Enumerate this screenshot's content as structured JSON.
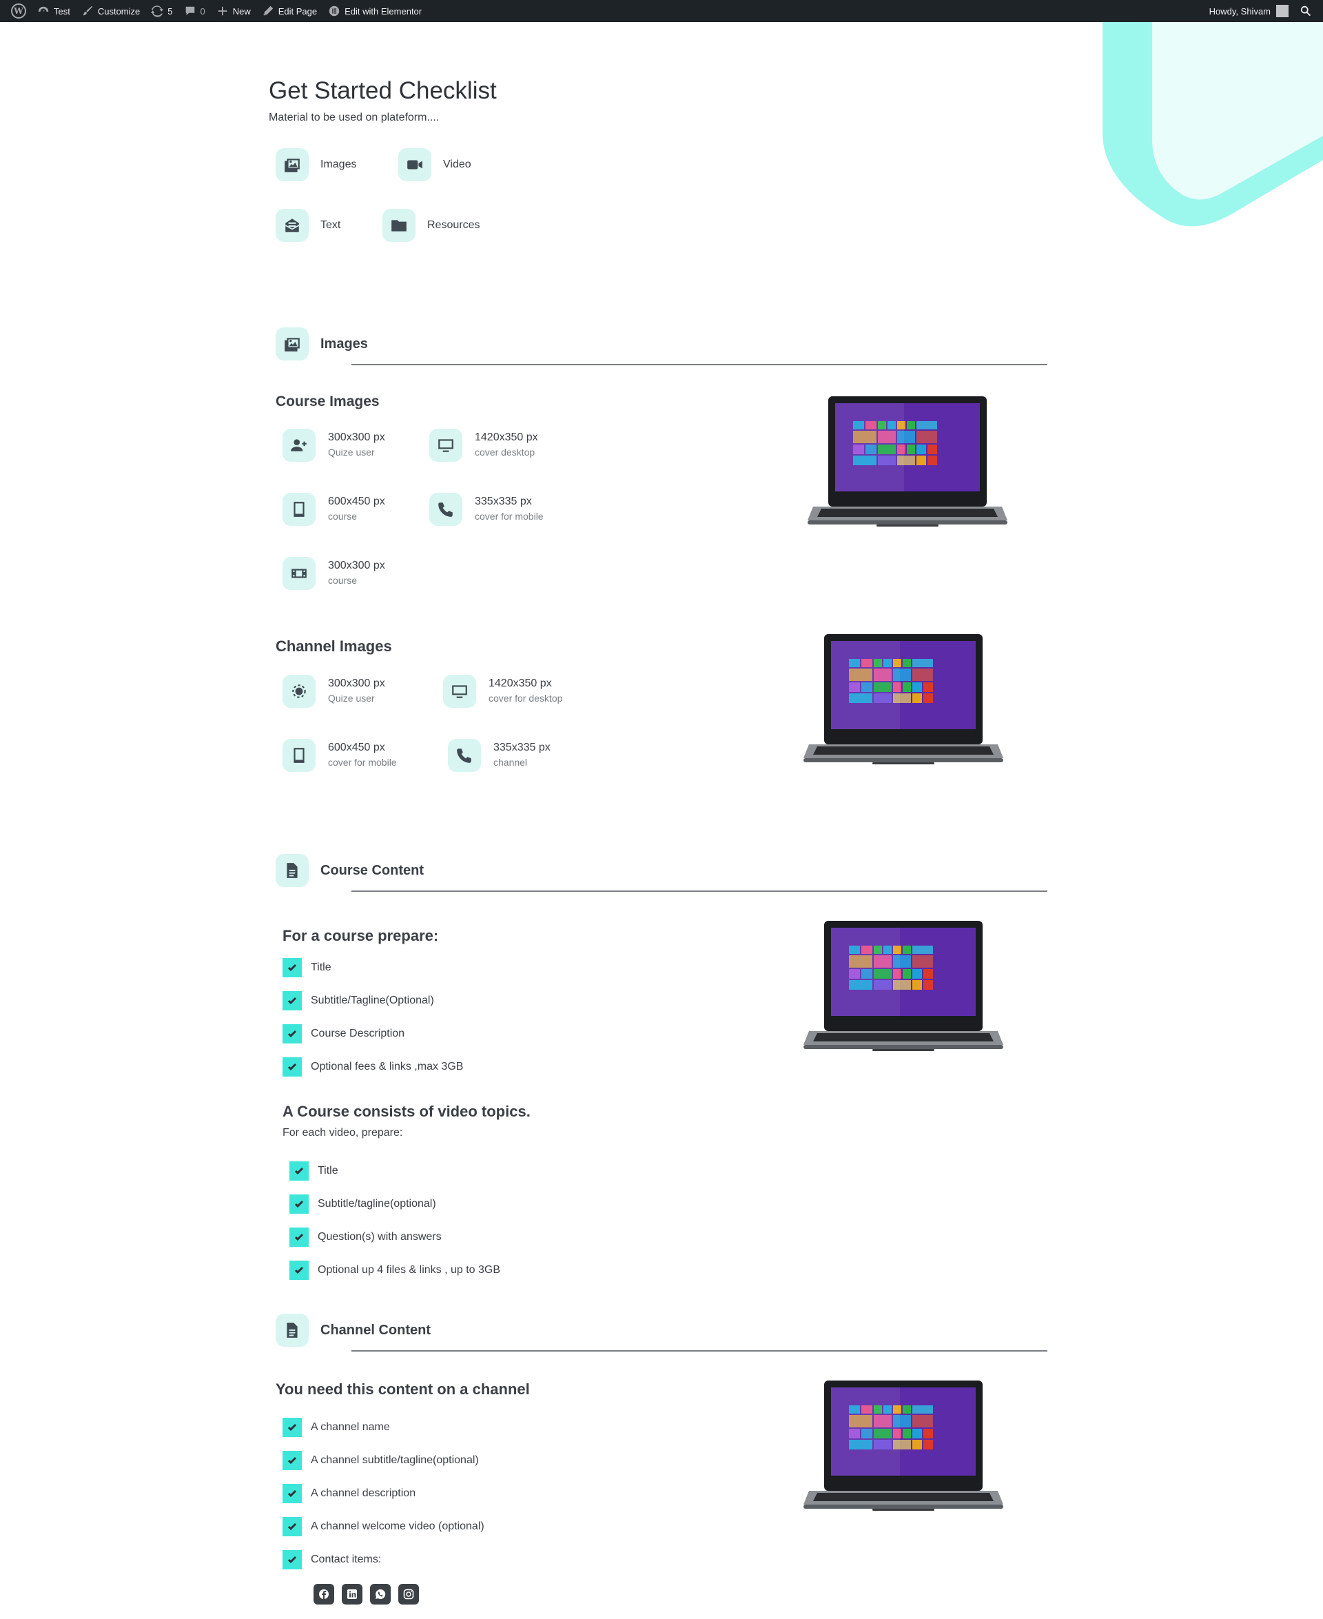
{
  "admin_bar": {
    "site_name": "Test",
    "customize": "Customize",
    "updates_count": "5",
    "comments_count": "0",
    "new": "New",
    "edit_page": "Edit Page",
    "edit_elementor": "Edit with Elementor",
    "howdy": "Howdy, Shivam"
  },
  "header": {
    "title": "Get Started Checklist",
    "subtitle": "Material to be used on plateform...."
  },
  "quick_links": [
    {
      "label": "Images",
      "icon": "images-icon"
    },
    {
      "label": "Video",
      "icon": "video-camera-icon"
    },
    {
      "label": "Text",
      "icon": "text-envelope-icon"
    },
    {
      "label": "Resources",
      "icon": "folder-icon"
    }
  ],
  "images_section": {
    "heading": "Images",
    "course_images": {
      "title": "Course Images",
      "items": [
        {
          "size": "300x300 px",
          "desc": "Quize user",
          "icon": "user-plus-icon"
        },
        {
          "size": "1420x350 px",
          "desc": "cover desktop",
          "icon": "desktop-icon"
        },
        {
          "size": "600x450 px",
          "desc": "course",
          "icon": "tablet-icon"
        },
        {
          "size": "335x335 px",
          "desc": "cover for mobile",
          "icon": "phone-icon"
        },
        {
          "size": "300x300 px",
          "desc": "course",
          "icon": "film-icon"
        }
      ]
    },
    "channel_images": {
      "title": "Channel Images",
      "items": [
        {
          "size": "300x300 px",
          "desc": "Quize user",
          "icon": "user-cog-icon"
        },
        {
          "size": "1420x350 px",
          "desc": "cover for desktop",
          "icon": "desktop-icon"
        },
        {
          "size": "600x450 px",
          "desc": "cover for mobile",
          "icon": "tablet-icon"
        },
        {
          "size": "335x335 px",
          "desc": "channel",
          "icon": "phone-icon"
        }
      ]
    }
  },
  "course_content": {
    "heading": "Course Content",
    "prepare_title": "For a course prepare:",
    "prepare_items": [
      "Title",
      "Subtitle/Tagline(Optional)",
      "Course Description",
      "Optional fees & links ,max 3GB"
    ],
    "video_title": "A Course consists of video topics.",
    "video_sub": "For each video, prepare:",
    "video_items": [
      "Title",
      "Subtitle/tagline(optional)",
      "Question(s) with answers",
      "Optional up 4 files & links , up to 3GB"
    ]
  },
  "channel_content": {
    "heading": "Channel Content",
    "need_title": "You need this content on a channel",
    "items": [
      "A channel name",
      "A channel subtitle/tagline(optional)",
      "A channel description",
      "A channel welcome video (optional)",
      "Contact items:"
    ],
    "social_icons": [
      "facebook-icon",
      "linkedin-icon",
      "whatsapp-icon",
      "instagram-icon"
    ]
  },
  "colors": {
    "accent": "#3ee6da",
    "icon_bg": "#d8f5f1",
    "deco": "#9cf7ec",
    "admin_bar": "#1d2327"
  }
}
